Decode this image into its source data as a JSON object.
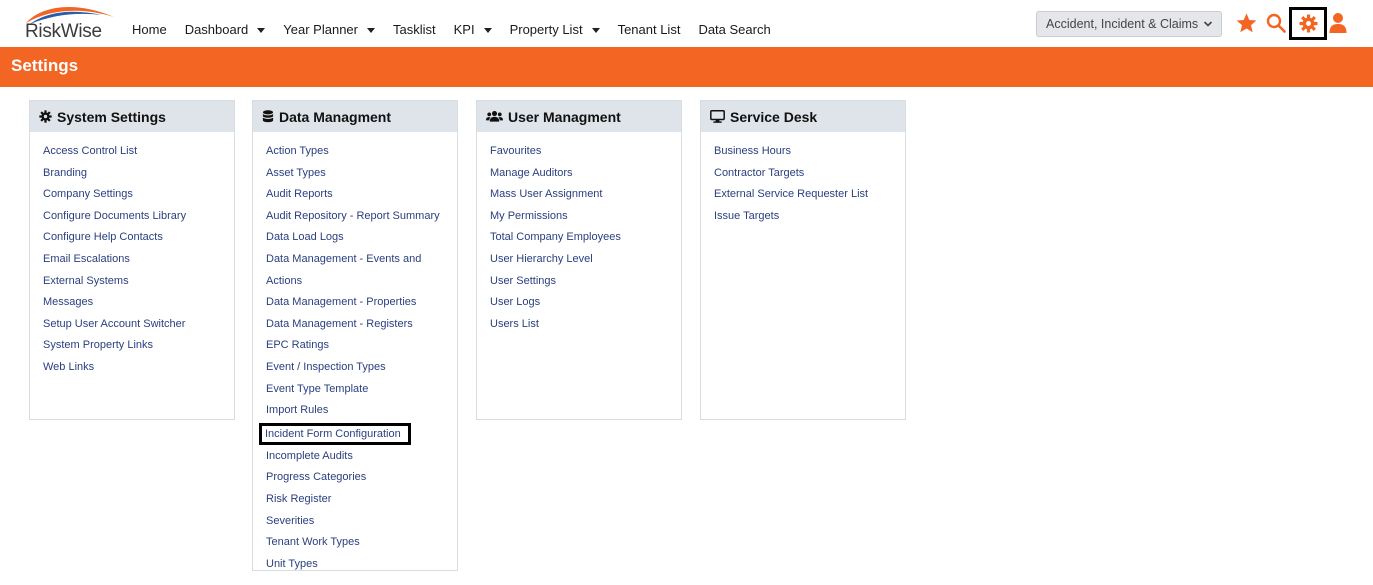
{
  "app": {
    "logo_text": "RiskWise"
  },
  "nav": {
    "items": [
      {
        "label": "Home",
        "has_dropdown": false
      },
      {
        "label": "Dashboard",
        "has_dropdown": true
      },
      {
        "label": "Year Planner",
        "has_dropdown": true
      },
      {
        "label": "Tasklist",
        "has_dropdown": false
      },
      {
        "label": "KPI",
        "has_dropdown": true
      },
      {
        "label": "Property List",
        "has_dropdown": true
      },
      {
        "label": "Tenant List",
        "has_dropdown": false
      },
      {
        "label": "Data Search",
        "has_dropdown": false
      }
    ]
  },
  "module_select": {
    "value": "Accident, Incident & Claims"
  },
  "icons": {
    "favourites": "star-icon",
    "search": "search-icon",
    "settings": "gear-icon",
    "user": "user-icon",
    "accent_color": "#f26522"
  },
  "header": {
    "title": "Settings",
    "color": "#f26522"
  },
  "panels": [
    {
      "title": "System Settings",
      "icon": "gear-icon",
      "links": [
        "Access Control List",
        "Branding",
        "Company Settings",
        "Configure Documents Library",
        "Configure Help Contacts",
        "Email Escalations",
        "External Systems",
        "Messages",
        "Setup User Account Switcher",
        "System Property Links",
        "Web Links"
      ]
    },
    {
      "title": "Data Managment",
      "icon": "database-icon",
      "links": [
        "Action Types",
        "Asset Types",
        "Audit Reports",
        "Audit Repository - Report Summary",
        "Data Load Logs",
        "Data Management - Events and Actions",
        "Data Management - Properties",
        "Data Management - Registers",
        "EPC Ratings",
        "Event / Inspection Types",
        "Event Type Template",
        "Import Rules",
        "Incident Form Configuration",
        "Incomplete Audits",
        "Progress Categories",
        "Risk Register",
        "Severities",
        "Tenant Work Types",
        "Unit Types"
      ]
    },
    {
      "title": "User Managment",
      "icon": "users-icon",
      "links": [
        "Favourites",
        "Manage Auditors",
        "Mass User Assignment",
        "My Permissions",
        "Total Company Employees",
        "User Hierarchy Level",
        "User Settings",
        "User Logs",
        "Users List"
      ]
    },
    {
      "title": "Service Desk",
      "icon": "monitor-icon",
      "links": [
        "Business Hours",
        "Contractor Targets",
        "External Service Requester List",
        "Issue Targets"
      ]
    }
  ]
}
